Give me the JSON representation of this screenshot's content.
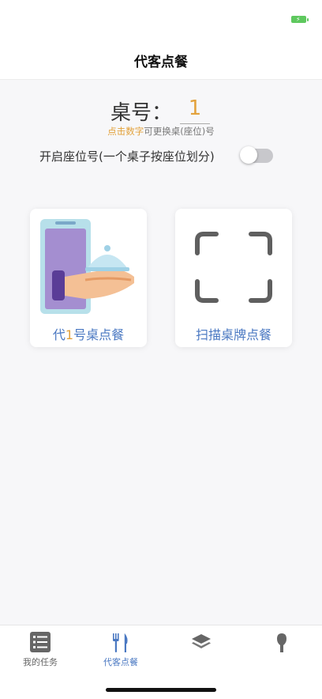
{
  "status": {
    "battery_icon": "battery-charging-icon"
  },
  "header": {
    "title": "代客点餐"
  },
  "table": {
    "label": "桌号：",
    "number": "1",
    "hint_highlight": "点击数字",
    "hint_rest": "可更换桌(座位)号"
  },
  "seat_toggle": {
    "label": "开启座位号(一个桌子按座位划分)",
    "enabled": false
  },
  "cards": {
    "proxy_order": {
      "prefix": "代",
      "number": "1",
      "suffix": "号桌点餐"
    },
    "scan_order": {
      "label": "扫描桌牌点餐"
    }
  },
  "tabs": [
    {
      "label": "我的任务",
      "icon": "task-list-icon",
      "active": false
    },
    {
      "label": "代客点餐",
      "icon": "fork-knife-icon",
      "active": true
    },
    {
      "label": "",
      "icon": "layers-icon",
      "active": false
    },
    {
      "label": "",
      "icon": "pin-icon",
      "active": false
    }
  ],
  "colors": {
    "accent": "#4a78c2",
    "highlight": "#e3a23c",
    "toggle_off": "#c8c8cc",
    "battery": "#5ec85e"
  }
}
